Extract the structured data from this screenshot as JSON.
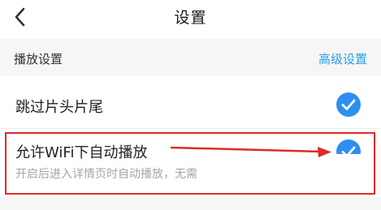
{
  "header": {
    "title": "设置",
    "back_icon": "chevron-left-icon"
  },
  "section": {
    "label": "播放设置",
    "advanced_link": "高级设置"
  },
  "settings": [
    {
      "label": "跳过片头片尾",
      "checked": true
    },
    {
      "label": "允许WiFi下自动播放",
      "description": "开启后进入详情页时自动播放，无需",
      "checked": true
    }
  ],
  "colors": {
    "accent": "#2e8ff0",
    "link": "#2aa0e8",
    "annotation": "#e02a2a"
  }
}
